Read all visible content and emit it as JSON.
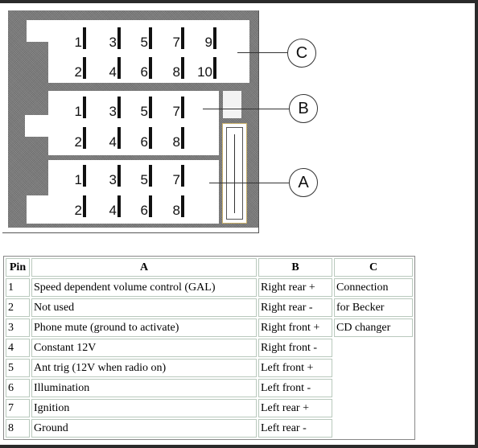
{
  "diagram": {
    "connectors": [
      {
        "label": "C",
        "pins_top": [
          "1",
          "3",
          "5",
          "7",
          "9"
        ],
        "pins_bottom": [
          "2",
          "4",
          "6",
          "8",
          "10"
        ]
      },
      {
        "label": "B",
        "pins_top": [
          "1",
          "3",
          "5",
          "7"
        ],
        "pins_bottom": [
          "2",
          "4",
          "6",
          "8"
        ]
      },
      {
        "label": "A",
        "pins_top": [
          "1",
          "3",
          "5",
          "7"
        ],
        "pins_bottom": [
          "2",
          "4",
          "6",
          "8"
        ]
      }
    ]
  },
  "table": {
    "headers": [
      "Pin",
      "A",
      "B",
      "C"
    ],
    "rows": [
      [
        "1",
        "Speed dependent volume control (GAL)",
        "Right rear  +",
        "Connection"
      ],
      [
        "2",
        "Not used",
        "Right rear -",
        "for Becker"
      ],
      [
        "3",
        "Phone mute (ground to activate)",
        "Right front +",
        "CD changer"
      ],
      [
        "4",
        "Constant 12V",
        "Right front -",
        ""
      ],
      [
        "5",
        "Ant trig (12V when radio on)",
        "Left front +",
        ""
      ],
      [
        "6",
        "Illumination",
        "Left front -",
        ""
      ],
      [
        "7",
        "Ignition",
        "Left rear +",
        ""
      ],
      [
        "8",
        "Ground",
        "Left rear -",
        ""
      ]
    ]
  }
}
